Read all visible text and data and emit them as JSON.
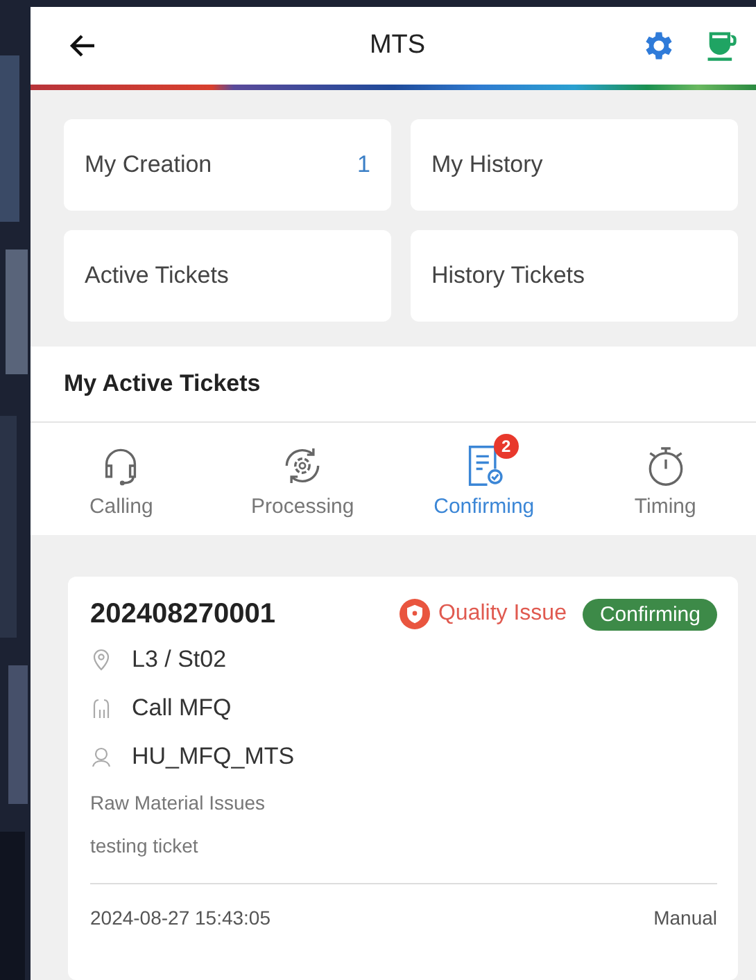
{
  "header": {
    "title": "MTS"
  },
  "quick_links": [
    {
      "label": "My Creation",
      "count": "1"
    },
    {
      "label": "My History"
    },
    {
      "label": "Active Tickets"
    },
    {
      "label": "History Tickets"
    }
  ],
  "section": {
    "title": "My Active Tickets"
  },
  "tabs": [
    {
      "label": "Calling",
      "selected": false
    },
    {
      "label": "Processing",
      "selected": false
    },
    {
      "label": "Confirming",
      "selected": true,
      "badge": "2"
    },
    {
      "label": "Timing",
      "selected": false
    }
  ],
  "ticket": {
    "number": "202408270001",
    "category": "Quality Issue",
    "status": "Confirming",
    "location": "L3 / St02",
    "call": "Call MFQ",
    "assignee": "HU_MFQ_MTS",
    "issue": "Raw Material Issues",
    "description": "testing ticket",
    "time": "2024-08-27 15:43:05",
    "mode": "Manual"
  }
}
